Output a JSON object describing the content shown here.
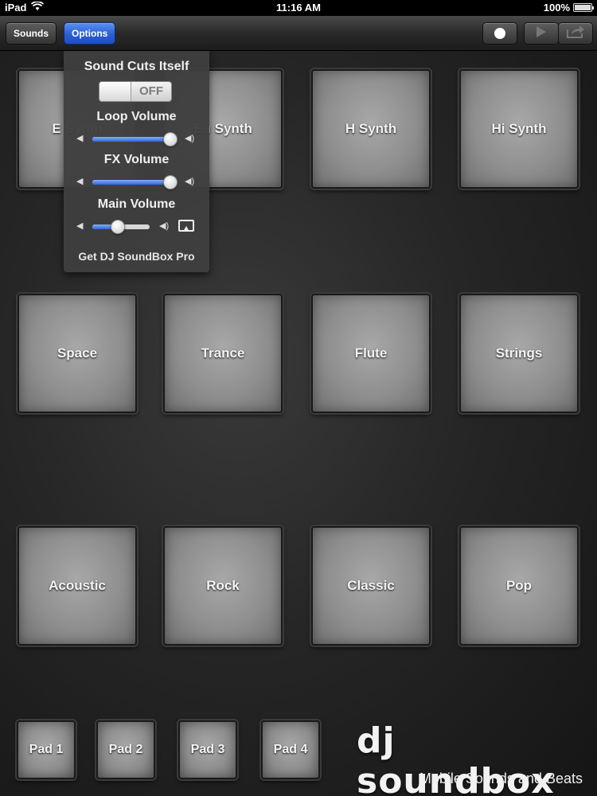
{
  "status_bar": {
    "device": "iPad",
    "time": "11:16 AM",
    "battery": "100%"
  },
  "toolbar": {
    "sounds_label": "Sounds",
    "options_label": "Options",
    "record_icon": "record-icon",
    "play_icon": "play-icon",
    "share_icon": "share-icon"
  },
  "options": {
    "sound_cuts_label": "Sound Cuts Itself",
    "sound_cuts_state": "OFF",
    "loop_volume_label": "Loop Volume",
    "loop_volume_level": 0.92,
    "fx_volume_label": "FX Volume",
    "fx_volume_level": 0.92,
    "main_volume_label": "Main Volume",
    "main_volume_level": 0.45,
    "pro_link": "Get DJ SoundBox Pro"
  },
  "pads": {
    "row1": [
      "E Synth",
      "Eu Synth",
      "H Synth",
      "Hi Synth"
    ],
    "row2": [
      "Space",
      "Trance",
      "Flute",
      "Strings"
    ],
    "row3": [
      "Acoustic",
      "Rock",
      "Classic",
      "Pop"
    ]
  },
  "small_pads": [
    "Pad 1",
    "Pad 2",
    "Pad 3",
    "Pad 4"
  ],
  "branding": {
    "logo": "dj soundbox",
    "tagline": "Mobile Sounds and Beats"
  }
}
